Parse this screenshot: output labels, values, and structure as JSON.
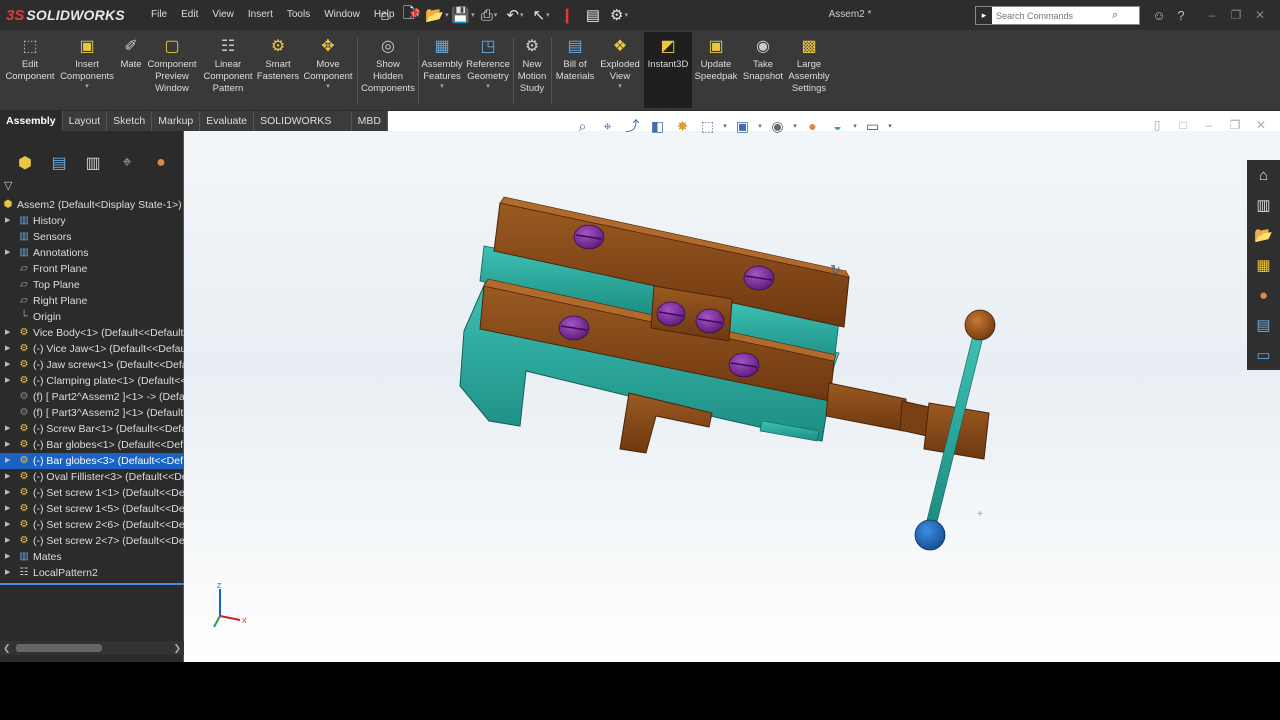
{
  "app": {
    "logo_ds": "3S",
    "logo_name": "SOLIDWORKS",
    "document_title": "Assem2 *"
  },
  "menu": [
    "File",
    "Edit",
    "View",
    "Insert",
    "Tools",
    "Window",
    "Help"
  ],
  "search": {
    "placeholder": "Search Commands"
  },
  "ribbon": {
    "edit_component": "Edit\nComponent",
    "insert_components": "Insert\nComponents",
    "mate": "Mate",
    "component_preview": "Component\nPreview\nWindow",
    "linear_pattern": "Linear\nComponent\nPattern",
    "smart_fasteners": "Smart\nFasteners",
    "move_component": "Move\nComponent",
    "show_hidden": "Show\nHidden\nComponents",
    "assembly_features": "Assembly\nFeatures",
    "reference_geometry": "Reference\nGeometry",
    "new_motion_study": "New\nMotion\nStudy",
    "bill_of_materials": "Bill of\nMaterials",
    "exploded_view": "Exploded\nView",
    "instant3d": "Instant3D",
    "update_speedpak": "Update\nSpeedpak",
    "take_snapshot": "Take\nSnapshot",
    "large_assembly": "Large\nAssembly\nSettings"
  },
  "tabs": [
    "Assembly",
    "Layout",
    "Sketch",
    "Markup",
    "Evaluate",
    "SOLIDWORKS Add-Ins",
    "MBD"
  ],
  "tree": {
    "root": "Assem2  (Default<Display State-1>)",
    "items": [
      "History",
      "Sensors",
      "Annotations",
      "Front Plane",
      "Top Plane",
      "Right Plane",
      "Origin",
      "Vice Body<1> (Default<<Default",
      "(-) Vice Jaw<1> (Default<<Default",
      "(-) Jaw screw<1> (Default<<Defa",
      "(-) Clamping plate<1> (Default<<",
      "(f) [ Part2^Assem2 ]<1> -> (Defa",
      "(f) [ Part3^Assem2 ]<1> (Default",
      "(-) Screw Bar<1> (Default<<Defa",
      "(-) Bar globes<1> (Default<<Def",
      "(-) Bar globes<3> (Default<<Def",
      "(-) Oval Fillister<3> (Default<<De",
      "(-) Set screw 1<1> (Default<<Def",
      "(-) Set screw 1<5> (Default<<Def",
      "(-) Set screw 2<6> (Default<<Def",
      "(-) Set screw 2<7> (Default<<Def",
      "Mates",
      "LocalPattern2"
    ]
  },
  "triad": {
    "z": "Z",
    "x": "X"
  },
  "colors": {
    "wood": "#8a4a18",
    "teal": "#2aa59a",
    "purple": "#7b2a9a",
    "selection": "#1a63c4"
  }
}
